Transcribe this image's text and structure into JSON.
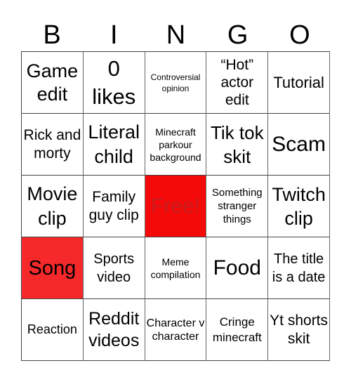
{
  "header": {
    "letters": [
      "B",
      "I",
      "N",
      "G",
      "O"
    ]
  },
  "colors": {
    "free_bg": "#f50a0a",
    "free_text": "#c81e1e",
    "marked_bg": "#f5282a"
  },
  "cells": [
    {
      "text": "Game edit"
    },
    {
      "text": "0 likes"
    },
    {
      "text": "Controversial opinion"
    },
    {
      "text": "“Hot” actor edit"
    },
    {
      "text": "Tutorial"
    },
    {
      "text": "Rick and morty"
    },
    {
      "text": "Literal child"
    },
    {
      "text": "Minecraft parkour background"
    },
    {
      "text": "Tik tok skit"
    },
    {
      "text": "Scam"
    },
    {
      "text": "Movie clip"
    },
    {
      "text": "Family guy clip"
    },
    {
      "text": "Free!",
      "free": true
    },
    {
      "text": "Something stranger things"
    },
    {
      "text": "Twitch clip"
    },
    {
      "text": "Song",
      "marked": true
    },
    {
      "text": "Sports video"
    },
    {
      "text": "Meme compilation"
    },
    {
      "text": "Food"
    },
    {
      "text": "The title is a date"
    },
    {
      "text": "Reaction"
    },
    {
      "text": "Reddit videos"
    },
    {
      "text": "Character v character"
    },
    {
      "text": "Cringe minecraft"
    },
    {
      "text": "Yt shorts skit"
    }
  ]
}
